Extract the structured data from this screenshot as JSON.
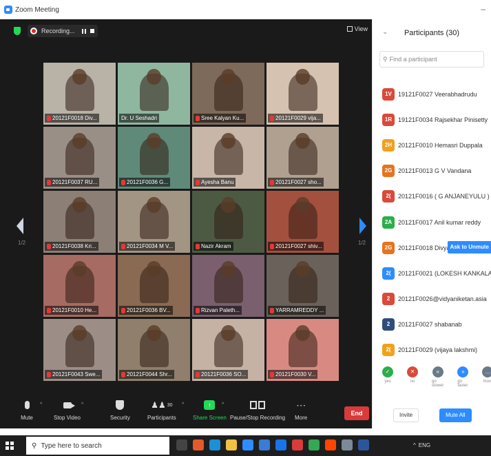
{
  "window": {
    "title": "Zoom Meeting"
  },
  "topbar": {
    "recording_label": "Recording...",
    "view_label": "View"
  },
  "tiles": [
    {
      "name": "20121F0018 Div...",
      "bg": "#b9b2a7"
    },
    {
      "name": "Dr. U Seshadri",
      "bg": "#8fb7a0",
      "active": true
    },
    {
      "name": "Sree Kalyan Ku...",
      "bg": "#7e6a5a"
    },
    {
      "name": "20121F0029 vija...",
      "bg": "#d6c2b0"
    },
    {
      "name": "20121F0037 RU...",
      "bg": "#9a8f86"
    },
    {
      "name": "20121F0036 G...",
      "bg": "#5f8a7a"
    },
    {
      "name": "Ayesha Banu",
      "bg": "#c8b6a8"
    },
    {
      "name": "20121F0027 sho...",
      "bg": "#b0a090"
    },
    {
      "name": "20121F0038 Kri...",
      "bg": "#8c7f76"
    },
    {
      "name": "20121F0034 M V...",
      "bg": "#a39583"
    },
    {
      "name": "Nazir Akram",
      "bg": "#4c5a44"
    },
    {
      "name": "20121F0027 shiv...",
      "bg": "#a4503f"
    },
    {
      "name": "20121F0010 He...",
      "bg": "#a66b62"
    },
    {
      "name": "20121F0036 BV...",
      "bg": "#8a6a52"
    },
    {
      "name": "Rizvan Paleth...",
      "bg": "#7a5f6e"
    },
    {
      "name": "YARRAMREDDY ...",
      "bg": "#6a625a"
    },
    {
      "name": "20121F0043 Swe...",
      "bg": "#9c8e86"
    },
    {
      "name": "20121F0044 Shr...",
      "bg": "#8f7f6c"
    },
    {
      "name": "20121F0036 SO...",
      "bg": "#c5b2a4"
    },
    {
      "name": "20121F0030 V...",
      "bg": "#d88a82"
    }
  ],
  "pagination": {
    "left": "1/2",
    "right": "1/2"
  },
  "toolbar": {
    "mute": "Mute",
    "video": "Stop Video",
    "security": "Security",
    "participants": "Participants",
    "participants_count": "30",
    "share": "Share Screen",
    "record": "Pause/Stop Recording",
    "more": "More",
    "end": "End"
  },
  "panel": {
    "title": "Participants (30)",
    "search_placeholder": "Find a participant",
    "participants": [
      {
        "initials": "1V",
        "name": "19121F0027 Veerabhadrudu",
        "color": "#d94a3a"
      },
      {
        "initials": "1R",
        "name": "19121F0034 Rajsekhar Pinisetty",
        "color": "#d94a3a"
      },
      {
        "initials": "2H",
        "name": "20121F0010 Hemasri Duppala",
        "color": "#f0a21b"
      },
      {
        "initials": "2G",
        "name": "20121F0013 G V Vandana",
        "color": "#e5741f"
      },
      {
        "initials": "2(",
        "name": "20121F0016 ( G ANJANEYULU )",
        "color": "#d94a3a"
      },
      {
        "initials": "2A",
        "name": "20121F0017 Anil kumar reddy",
        "color": "#2cae4a"
      },
      {
        "initials": "2G",
        "name": "20121F0018 Divya...",
        "color": "#e5741f",
        "action": "Ask to Unmute"
      },
      {
        "initials": "2(",
        "name": "20121F0021 (LOKESH KANKALA)",
        "color": "#2d8cff"
      },
      {
        "initials": "2",
        "name": "20121F0026@vidyaniketan.asia",
        "color": "#d94a3a"
      },
      {
        "initials": "2",
        "name": "20121F0027 shabanab",
        "color": "#2f4d7a"
      },
      {
        "initials": "2(",
        "name": "20121F0029 (vijaya lakshmi)",
        "color": "#f0a21b"
      }
    ],
    "reactions": [
      {
        "label": "yes",
        "glyph": "✓",
        "color": "#2cae4a"
      },
      {
        "label": "no",
        "glyph": "✕",
        "color": "#d94a3a"
      },
      {
        "label": "go slower",
        "glyph": "«",
        "color": "#6a7a8a"
      },
      {
        "label": "go faster",
        "glyph": "»",
        "color": "#2d8cff"
      },
      {
        "label": "more",
        "glyph": "…",
        "color": "#6a7a8a"
      }
    ],
    "invite": "Invite",
    "mute_all": "Mute All"
  },
  "taskbar": {
    "search_placeholder": "Type here to search",
    "lang": "ENG"
  }
}
